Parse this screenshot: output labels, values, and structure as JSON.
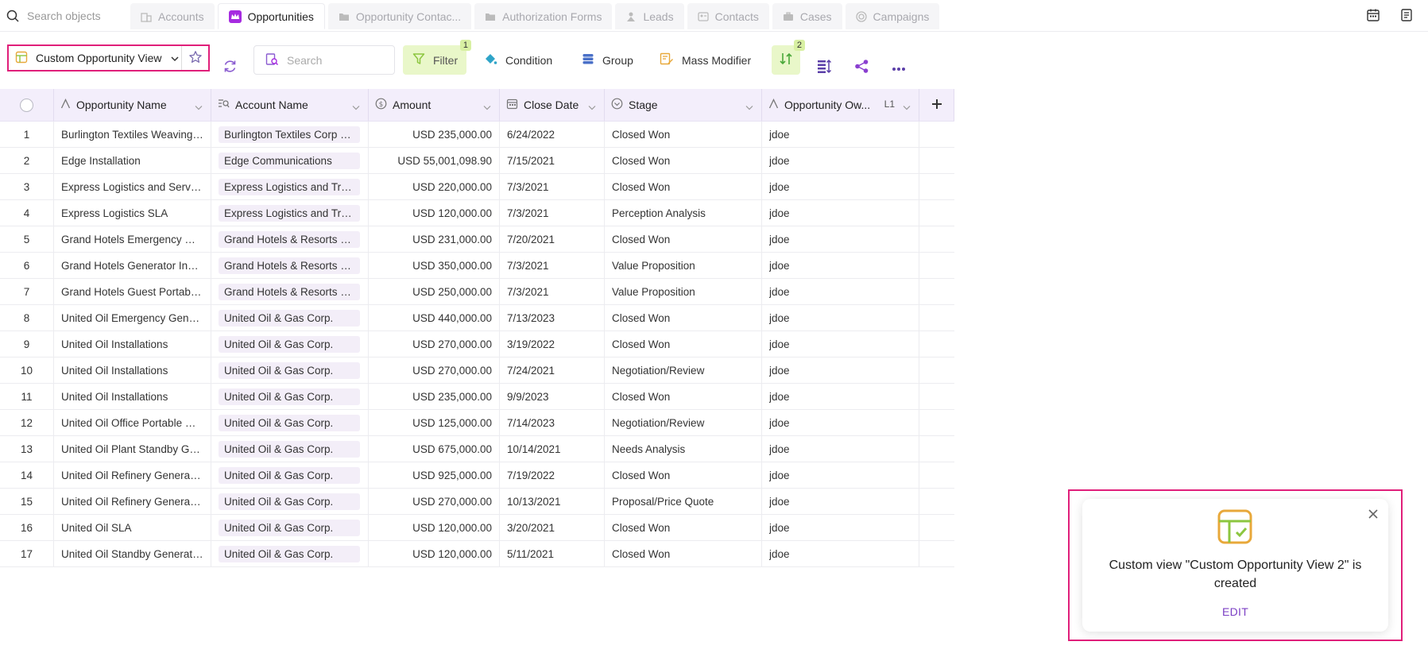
{
  "topbar": {
    "search_placeholder": "Search objects",
    "tabs": [
      {
        "label": "Accounts",
        "icon": "building-icon",
        "active": false
      },
      {
        "label": "Opportunities",
        "icon": "crown-icon",
        "active": true
      },
      {
        "label": "Opportunity Contac...",
        "icon": "folder-icon",
        "active": false
      },
      {
        "label": "Authorization Forms",
        "icon": "folder-icon",
        "active": false
      },
      {
        "label": "Leads",
        "icon": "person-star-icon",
        "active": false
      },
      {
        "label": "Contacts",
        "icon": "contact-card-icon",
        "active": false
      },
      {
        "label": "Cases",
        "icon": "briefcase-icon",
        "active": false
      },
      {
        "label": "Campaigns",
        "icon": "target-icon",
        "active": false
      }
    ]
  },
  "toolbar": {
    "view_label": "Custom Opportunity View 2",
    "search_placeholder": "Search",
    "filter_label": "Filter",
    "filter_count": "1",
    "condition_label": "Condition",
    "group_label": "Group",
    "mass_modifier_label": "Mass Modifier",
    "sort_count": "2"
  },
  "grid": {
    "columns": {
      "name": "Opportunity Name",
      "account": "Account Name",
      "amount": "Amount",
      "close_date": "Close Date",
      "stage": "Stage",
      "owner": "Opportunity Ow...",
      "owner_suffix": "L1"
    },
    "rows": [
      {
        "n": "1",
        "name": "Burlington Textiles Weaving Plant Generator",
        "account": "Burlington Textiles Corp of America",
        "amount": "USD 235,000.00",
        "date": "6/24/2022",
        "stage": "Closed Won",
        "owner": "jdoe"
      },
      {
        "n": "2",
        "name": "Edge Installation",
        "account": "Edge Communications",
        "amount": "USD 55,001,098.90",
        "date": "7/15/2021",
        "stage": "Closed Won",
        "owner": "jdoe"
      },
      {
        "n": "3",
        "name": "Express Logistics and Services",
        "account": "Express Logistics and Transport",
        "amount": "USD 220,000.00",
        "date": "7/3/2021",
        "stage": "Closed Won",
        "owner": "jdoe"
      },
      {
        "n": "4",
        "name": "Express Logistics SLA",
        "account": "Express Logistics and Transport",
        "amount": "USD 120,000.00",
        "date": "7/3/2021",
        "stage": "Perception Analysis",
        "owner": "jdoe"
      },
      {
        "n": "5",
        "name": "Grand Hotels Emergency Generators",
        "account": "Grand Hotels & Resorts Ltd",
        "amount": "USD 231,000.00",
        "date": "7/20/2021",
        "stage": "Closed Won",
        "owner": "jdoe"
      },
      {
        "n": "6",
        "name": "Grand Hotels Generator Installations",
        "account": "Grand Hotels & Resorts Ltd",
        "amount": "USD 350,000.00",
        "date": "7/3/2021",
        "stage": "Value Proposition",
        "owner": "jdoe"
      },
      {
        "n": "7",
        "name": "Grand Hotels Guest Portable Generators",
        "account": "Grand Hotels & Resorts Ltd",
        "amount": "USD 250,000.00",
        "date": "7/3/2021",
        "stage": "Value Proposition",
        "owner": "jdoe"
      },
      {
        "n": "8",
        "name": "United Oil Emergency Generators",
        "account": "United Oil & Gas Corp.",
        "amount": "USD 440,000.00",
        "date": "7/13/2023",
        "stage": "Closed Won",
        "owner": "jdoe"
      },
      {
        "n": "9",
        "name": "United Oil Installations",
        "account": "United Oil & Gas Corp.",
        "amount": "USD 270,000.00",
        "date": "3/19/2022",
        "stage": "Closed Won",
        "owner": "jdoe"
      },
      {
        "n": "10",
        "name": "United Oil Installations",
        "account": "United Oil & Gas Corp.",
        "amount": "USD 270,000.00",
        "date": "7/24/2021",
        "stage": "Negotiation/Review",
        "owner": "jdoe"
      },
      {
        "n": "11",
        "name": "United Oil Installations",
        "account": "United Oil & Gas Corp.",
        "amount": "USD 235,000.00",
        "date": "9/9/2023",
        "stage": "Closed Won",
        "owner": "jdoe"
      },
      {
        "n": "12",
        "name": "United Oil Office Portable Generators",
        "account": "United Oil & Gas Corp.",
        "amount": "USD 125,000.00",
        "date": "7/14/2023",
        "stage": "Negotiation/Review",
        "owner": "jdoe"
      },
      {
        "n": "13",
        "name": "United Oil Plant Standby Generators",
        "account": "United Oil & Gas Corp.",
        "amount": "USD 675,000.00",
        "date": "10/14/2021",
        "stage": "Needs Analysis",
        "owner": "jdoe"
      },
      {
        "n": "14",
        "name": "United Oil Refinery Generators",
        "account": "United Oil & Gas Corp.",
        "amount": "USD 925,000.00",
        "date": "7/19/2022",
        "stage": "Closed Won",
        "owner": "jdoe"
      },
      {
        "n": "15",
        "name": "United Oil Refinery Generators",
        "account": "United Oil & Gas Corp.",
        "amount": "USD 270,000.00",
        "date": "10/13/2021",
        "stage": "Proposal/Price Quote",
        "owner": "jdoe"
      },
      {
        "n": "16",
        "name": "United Oil SLA",
        "account": "United Oil & Gas Corp.",
        "amount": "USD 120,000.00",
        "date": "3/20/2021",
        "stage": "Closed Won",
        "owner": "jdoe"
      },
      {
        "n": "17",
        "name": "United Oil Standby Generators",
        "account": "United Oil & Gas Corp.",
        "amount": "USD 120,000.00",
        "date": "5/11/2021",
        "stage": "Closed Won",
        "owner": "jdoe"
      }
    ]
  },
  "toast": {
    "message": "Custom view \"Custom Opportunity View 2\" is created",
    "action": "EDIT"
  },
  "colors": {
    "accent_purple": "#a62be0",
    "highlight_pink": "#e01f7a",
    "filter_green": "#e9f7c9",
    "header_bg": "#f3eefb"
  }
}
